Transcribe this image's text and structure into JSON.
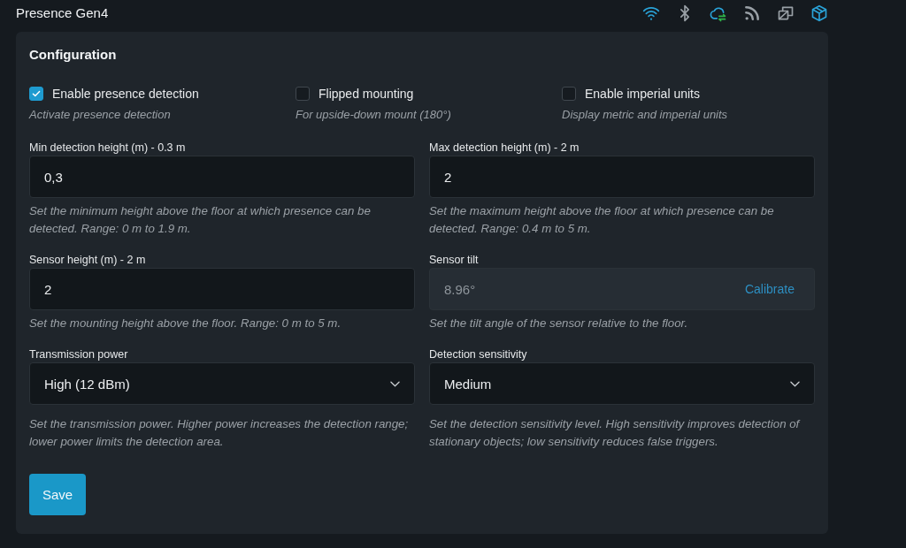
{
  "header": {
    "title": "Presence Gen4",
    "status_icons": [
      {
        "active": true
      },
      {
        "active": false
      },
      {
        "active": true
      },
      {
        "active": false
      },
      {
        "active": false
      },
      {
        "active": true
      }
    ]
  },
  "configuration": {
    "title": "Configuration",
    "options": [
      {
        "label": "Enable presence detection",
        "description": "Activate presence detection",
        "checked": true
      },
      {
        "label": "Flipped mounting",
        "description": "For upside-down mount (180°)",
        "checked": false
      },
      {
        "label": "Enable imperial units",
        "description": "Display metric and imperial units",
        "checked": false
      }
    ],
    "fields": [
      {
        "kind": "input",
        "label": "Min detection height (m) - 0.3 m",
        "value": "0,3",
        "disabled": false,
        "help": "Set the minimum height above the floor at which presence can be detected. Range: 0 m to 1.9 m."
      },
      {
        "kind": "input",
        "label": "Max detection height (m) - 2 m",
        "value": "2",
        "disabled": false,
        "help": "Set the maximum height above the floor at which presence can be detected. Range: 0.4 m to 5 m."
      },
      {
        "kind": "input",
        "label": "Sensor height (m) - 2 m",
        "value": "2",
        "disabled": false,
        "help": "Set the mounting height above the floor. Range: 0 m to 5 m."
      },
      {
        "kind": "input_action",
        "label": "Sensor tilt",
        "value": "8.96°",
        "disabled": true,
        "action": "Calibrate",
        "help": "Set the tilt angle of the sensor relative to the floor."
      },
      {
        "kind": "select",
        "label": "Transmission power",
        "value": "High (12 dBm)",
        "disabled": false,
        "help": "Set the transmission power. Higher power increases the detection range; lower power limits the detection area."
      },
      {
        "kind": "select",
        "label": "Detection sensitivity",
        "value": "Medium",
        "disabled": false,
        "help": "Set the detection sensitivity level. High sensitivity improves detection of stationary objects; low sensitivity reduces false triggers."
      }
    ],
    "save_button": "Save"
  }
}
